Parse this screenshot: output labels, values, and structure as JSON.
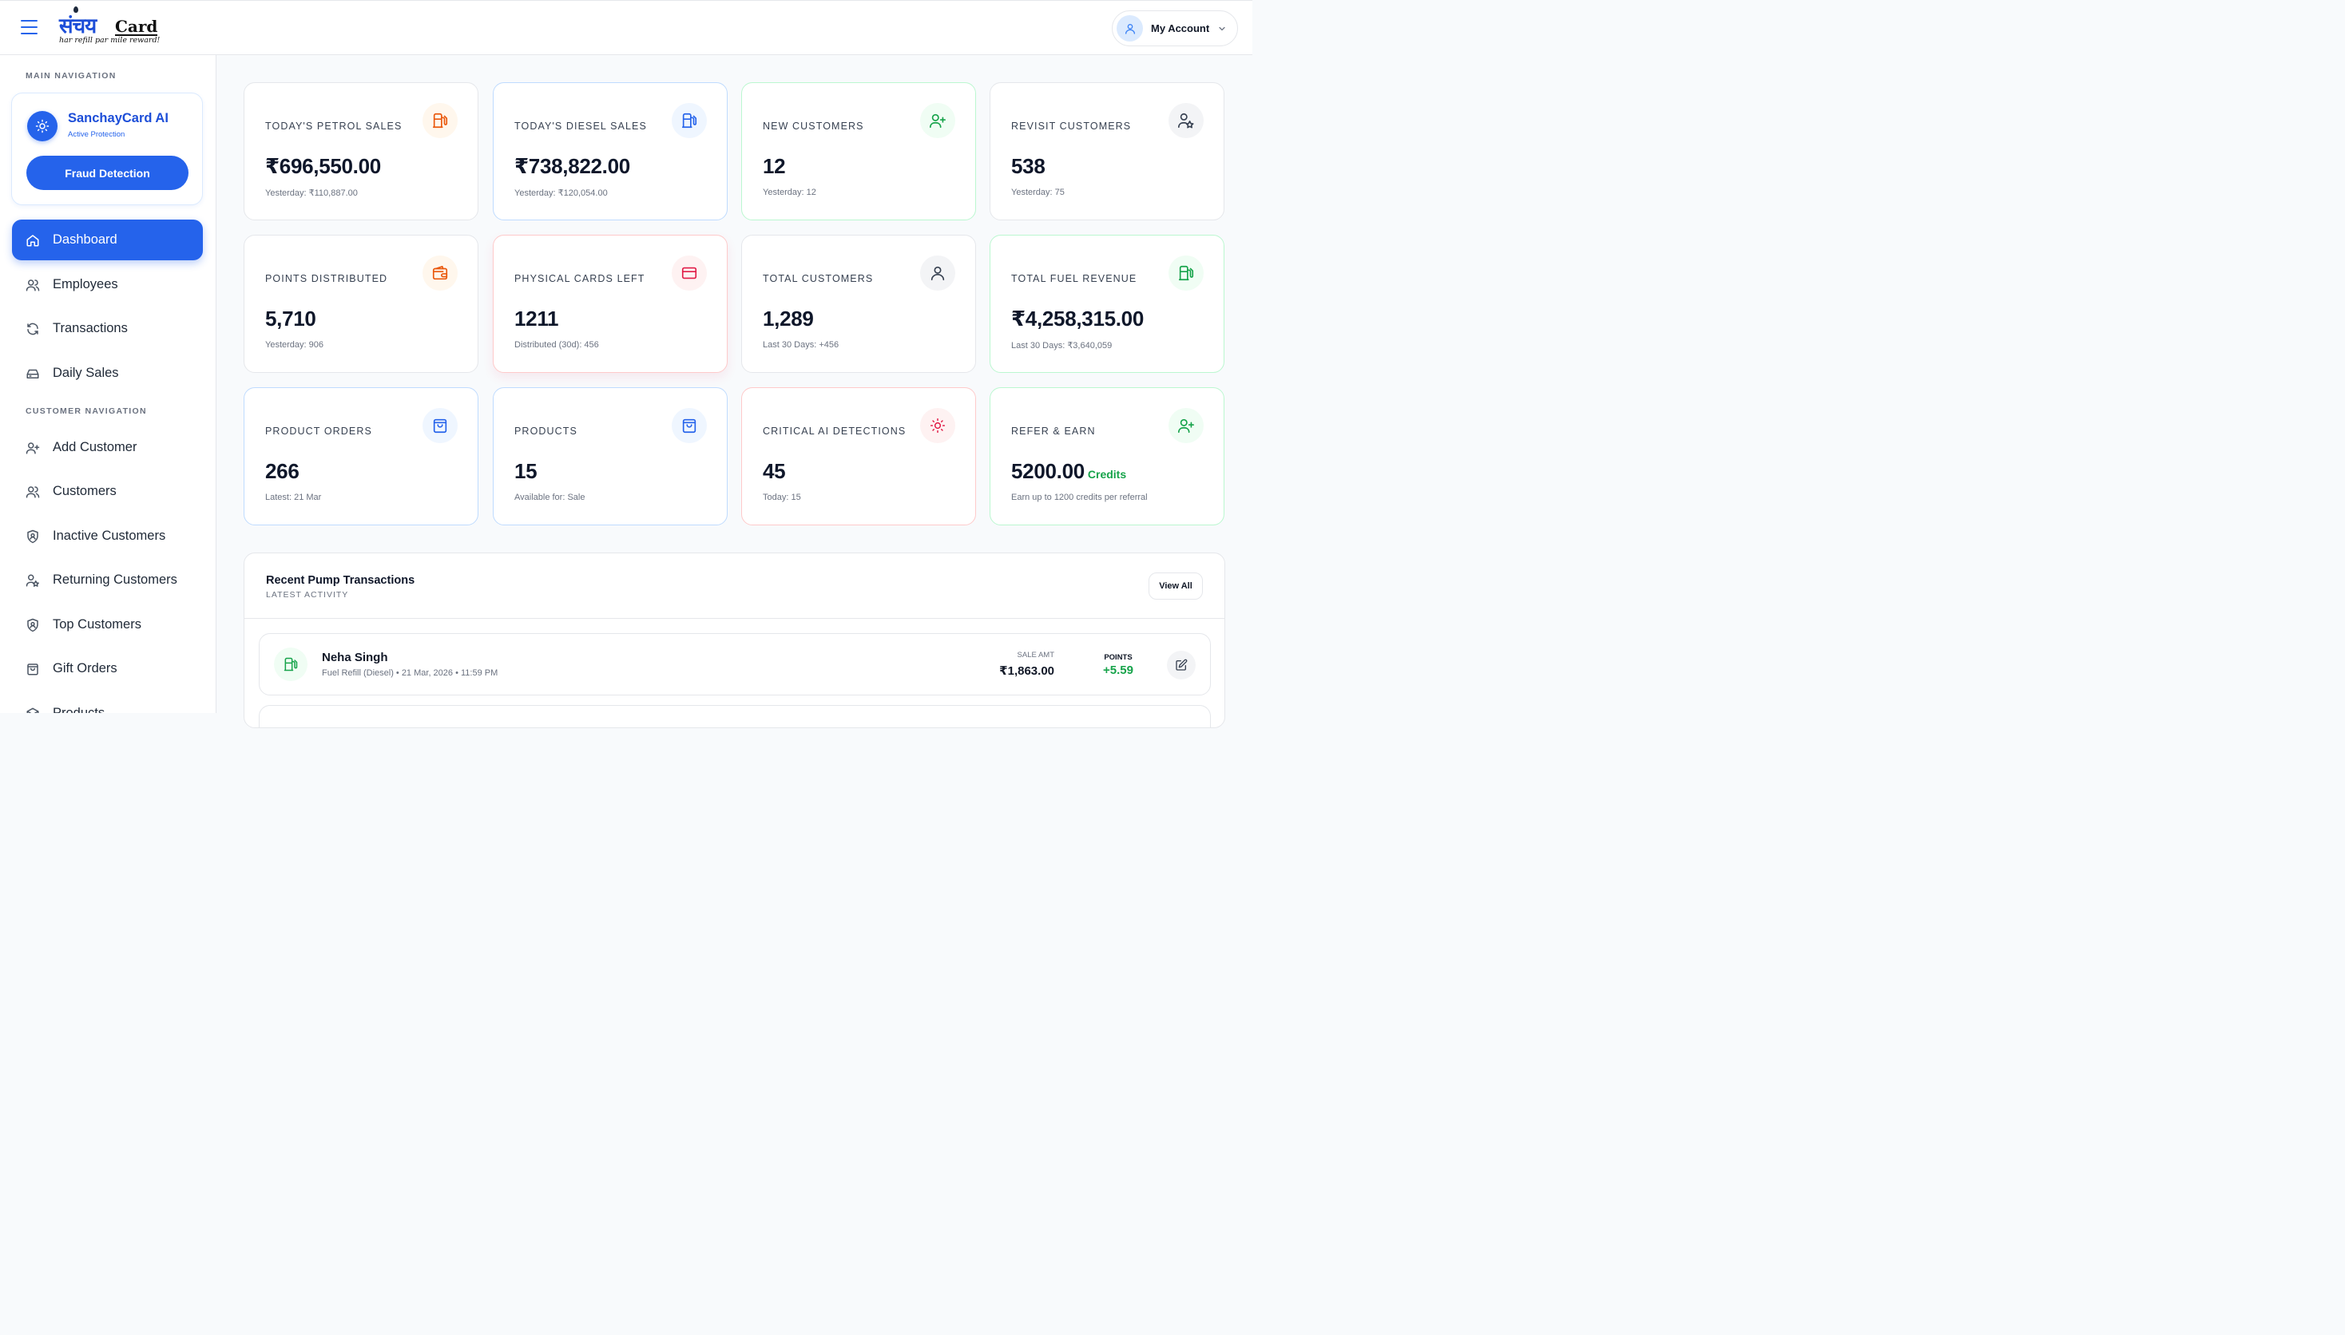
{
  "header": {
    "logo_main": "संचय",
    "logo_card": "Card",
    "logo_tagline": "har refill par mile reward!",
    "account_label": "My Account"
  },
  "sidebar": {
    "main_heading": "MAIN NAVIGATION",
    "ai_card": {
      "title": "SanchayCard AI",
      "subtitle": "Active Protection",
      "button": "Fraud Detection"
    },
    "main_items": [
      {
        "label": "Dashboard",
        "icon": "home-icon",
        "active": true
      },
      {
        "label": "Employees",
        "icon": "users-icon"
      },
      {
        "label": "Transactions",
        "icon": "refresh-icon"
      },
      {
        "label": "Daily Sales",
        "icon": "sales-icon"
      }
    ],
    "customer_heading": "CUSTOMER NAVIGATION",
    "customer_items": [
      {
        "label": "Add Customer",
        "icon": "user-plus-icon"
      },
      {
        "label": "Customers",
        "icon": "users-icon"
      },
      {
        "label": "Inactive Customers",
        "icon": "shield-icon"
      },
      {
        "label": "Returning Customers",
        "icon": "user-star-icon"
      },
      {
        "label": "Top Customers",
        "icon": "shield-icon"
      },
      {
        "label": "Gift Orders",
        "icon": "bag-icon"
      },
      {
        "label": "Products",
        "icon": "box-icon"
      }
    ]
  },
  "stats": [
    {
      "label": "TODAY'S PETROL SALES",
      "value": "₹696,550.00",
      "sub": "Yesterday: ₹110,887.00",
      "icon": "fuel-pump-icon",
      "tone": "orange"
    },
    {
      "label": "TODAY'S DIESEL SALES",
      "value": "₹738,822.00",
      "sub": "Yesterday: ₹120,054.00",
      "icon": "fuel-pump-icon",
      "tone": "blue"
    },
    {
      "label": "NEW CUSTOMERS",
      "value": "12",
      "sub": "Yesterday: 12",
      "icon": "user-plus-icon",
      "tone": "green"
    },
    {
      "label": "REVISIT CUSTOMERS",
      "value": "538",
      "sub": "Yesterday: 75",
      "icon": "user-star-icon",
      "tone": "gray"
    },
    {
      "label": "POINTS DISTRIBUTED",
      "value": "5,710",
      "sub": "Yesterday: 906",
      "icon": "wallet-icon",
      "tone": "orange"
    },
    {
      "label": "PHYSICAL CARDS LEFT",
      "value": "1211",
      "sub": "Distributed (30d): 456",
      "icon": "credit-card-icon",
      "tone": "red"
    },
    {
      "label": "TOTAL CUSTOMERS",
      "value": "1,289",
      "sub": "Last 30 Days: +456",
      "icon": "user-icon",
      "tone": "gray"
    },
    {
      "label": "TOTAL FUEL REVENUE",
      "value": "₹4,258,315.00",
      "sub": "Last 30 Days: ₹3,640,059",
      "icon": "fuel-pump-icon",
      "tone": "green"
    },
    {
      "label": "PRODUCT ORDERS",
      "value": "266",
      "sub": "Latest: 21 Mar",
      "icon": "bag-icon",
      "tone": "blue"
    },
    {
      "label": "PRODUCTS",
      "value": "15",
      "sub": "Available for: Sale",
      "icon": "bag-icon",
      "tone": "blue"
    },
    {
      "label": "CRITICAL AI DETECTIONS",
      "value": "45",
      "sub": "Today: 15",
      "icon": "sun-icon",
      "tone": "red"
    },
    {
      "label": "REFER & EARN",
      "value": "5200.00",
      "value_suffix": "Credits",
      "sub": "Earn up to 1200 credits per referral",
      "icon": "user-plus-icon",
      "tone": "green"
    }
  ],
  "transactions": {
    "title": "Recent Pump Transactions",
    "subtitle": "LATEST ACTIVITY",
    "view_all": "View All",
    "rows": [
      {
        "name": "Neha Singh",
        "meta": "Fuel Refill (Diesel) • 21 Mar, 2026 • 11:59 PM",
        "amount_label": "SALE AMT",
        "amount": "₹1,863.00",
        "points_label": "POINTS",
        "points": "+5.59"
      }
    ]
  },
  "colors": {
    "accent": "#2563eb",
    "orange": "#ea580c",
    "green": "#16a34a",
    "red": "#e11d48"
  }
}
